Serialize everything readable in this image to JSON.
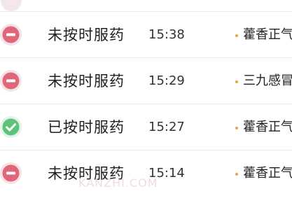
{
  "colors": {
    "missed": "#e0677a",
    "taken": "#5fc27a",
    "dot": "#f0a040"
  },
  "records": [
    {
      "status": "missed",
      "status_icon": "minus-circle-icon",
      "label": "未按时服药",
      "time": "15:38",
      "medicine": "藿香正气"
    },
    {
      "status": "missed",
      "status_icon": "minus-circle-icon",
      "label": "未按时服药",
      "time": "15:29",
      "medicine": "三九感冒"
    },
    {
      "status": "taken",
      "status_icon": "check-circle-icon",
      "label": "已按时服药",
      "time": "15:27",
      "medicine": "藿香正气"
    },
    {
      "status": "missed",
      "status_icon": "minus-circle-icon",
      "label": "未按时服药",
      "time": "15:14",
      "medicine": "藿香正气"
    }
  ],
  "watermark": "KANZHI.COM"
}
